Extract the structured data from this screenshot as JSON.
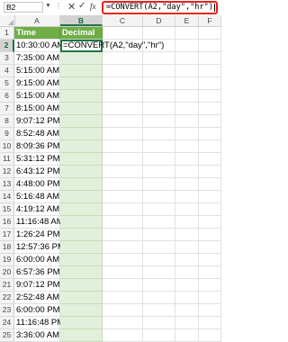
{
  "formula_bar": {
    "name_box": "B2",
    "fx_label": "fx",
    "formula": "=CONVERT(A2,\"day\",\"hr\")"
  },
  "columns": [
    "A",
    "B",
    "C",
    "D",
    "E",
    "F"
  ],
  "headers": {
    "a": "Time",
    "b": "Decimal"
  },
  "active_cell_text": "=CONVERT(A2,\"day\",\"hr\")",
  "rows": [
    {
      "n": "1"
    },
    {
      "n": "2",
      "time": "10:30:00 AM"
    },
    {
      "n": "3",
      "time": "7:35:00 AM"
    },
    {
      "n": "4",
      "time": "5:15:00 AM"
    },
    {
      "n": "5",
      "time": "9:15:00 AM"
    },
    {
      "n": "6",
      "time": "5:15:00 AM"
    },
    {
      "n": "7",
      "time": "8:15:00 AM"
    },
    {
      "n": "8",
      "time": "9:07:12 PM"
    },
    {
      "n": "9",
      "time": "8:52:48 AM"
    },
    {
      "n": "10",
      "time": "8:09:36 PM"
    },
    {
      "n": "11",
      "time": "5:31:12 PM"
    },
    {
      "n": "12",
      "time": "6:43:12 PM"
    },
    {
      "n": "13",
      "time": "4:48:00 PM"
    },
    {
      "n": "14",
      "time": "5:16:48 AM"
    },
    {
      "n": "15",
      "time": "4:19:12 AM"
    },
    {
      "n": "16",
      "time": "11:16:48 AM"
    },
    {
      "n": "17",
      "time": "1:26:24 PM"
    },
    {
      "n": "18",
      "time": "12:57:36 PM"
    },
    {
      "n": "19",
      "time": "6:00:00 AM"
    },
    {
      "n": "20",
      "time": "6:57:36 PM"
    },
    {
      "n": "21",
      "time": "9:07:12 PM"
    },
    {
      "n": "22",
      "time": "2:52:48 AM"
    },
    {
      "n": "23",
      "time": "6:00:00 PM"
    },
    {
      "n": "24",
      "time": "11:16:48 PM"
    },
    {
      "n": "25",
      "time": "3:36:00 AM"
    }
  ]
}
